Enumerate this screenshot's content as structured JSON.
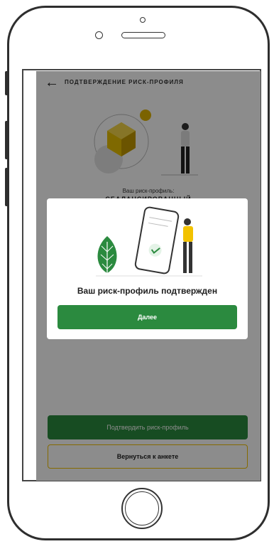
{
  "header": {
    "back_icon": "arrow-left-icon",
    "title": "ПОДТВЕРЖДЕНИЕ РИСК-ПРОФИЛЯ"
  },
  "profile": {
    "label": "Ваш риск-профиль:",
    "value": "СБАЛАНСИРОВАННЫЙ"
  },
  "actions": {
    "confirm_label": "Подтвердить риск-профиль",
    "return_label": "Вернуться к анкете"
  },
  "modal": {
    "title": "Ваш риск-профиль подтвержден",
    "next_label": "Далее"
  },
  "colors": {
    "primary_green": "#2b8a3f",
    "accent_yellow": "#f2c200",
    "overlay": "rgba(0,0,0,0.45)"
  }
}
